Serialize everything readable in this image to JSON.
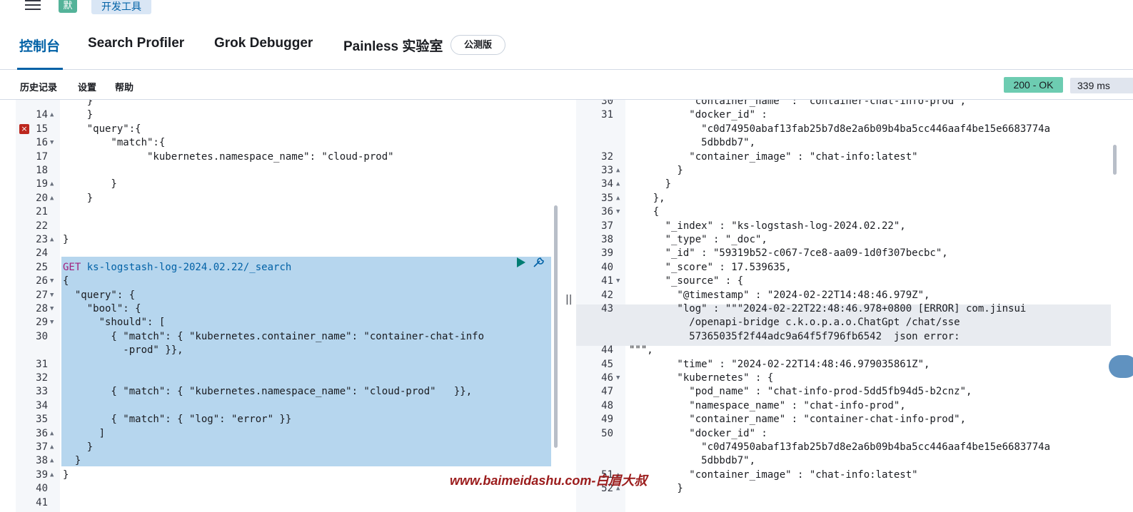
{
  "topbar": {
    "space_initial": "默",
    "breadcrumb": "开发工具"
  },
  "tabs": [
    {
      "label": "控制台",
      "active": true
    },
    {
      "label": "Search Profiler",
      "active": false
    },
    {
      "label": "Grok Debugger",
      "active": false
    },
    {
      "label": "Painless 实验室",
      "active": false
    }
  ],
  "beta_badge": "公测版",
  "toolbar": {
    "history": "历史记录",
    "settings": "设置",
    "help": "帮助",
    "status": "200 - OK",
    "duration": "339 ms"
  },
  "request_editor": {
    "lines": [
      {
        "n": "",
        "text": "    }"
      },
      {
        "n": "14",
        "text": "    }"
      },
      {
        "n": "15",
        "text": "    \"query\":{"
      },
      {
        "n": "16",
        "text": "        \"match\":{"
      },
      {
        "n": "17",
        "text": "              \"kubernetes.namespace_name\": \"cloud-prod\""
      },
      {
        "n": "18",
        "text": ""
      },
      {
        "n": "19",
        "text": "        }"
      },
      {
        "n": "20",
        "text": "    }"
      },
      {
        "n": "21",
        "text": ""
      },
      {
        "n": "22",
        "text": ""
      },
      {
        "n": "23",
        "text": "}"
      },
      {
        "n": "24",
        "text": ""
      },
      {
        "n": "25",
        "text": "GET ks-logstash-log-2024.02.22/_search"
      },
      {
        "n": "26",
        "text": "{"
      },
      {
        "n": "27",
        "text": "  \"query\": {"
      },
      {
        "n": "28",
        "text": "    \"bool\": {"
      },
      {
        "n": "29",
        "text": "      \"should\": ["
      },
      {
        "n": "30",
        "text": "        { \"match\": { \"kubernetes.container_name\": \"container-chat-info"
      },
      {
        "n": "",
        "text": "          -prod\" }},"
      },
      {
        "n": "31",
        "text": ""
      },
      {
        "n": "32",
        "text": ""
      },
      {
        "n": "33",
        "text": "        { \"match\": { \"kubernetes.namespace_name\": \"cloud-prod\"   }},"
      },
      {
        "n": "34",
        "text": ""
      },
      {
        "n": "35",
        "text": "        { \"match\": { \"log\": \"error\" }}"
      },
      {
        "n": "36",
        "text": "      ]"
      },
      {
        "n": "37",
        "text": "    }"
      },
      {
        "n": "38",
        "text": "  }"
      },
      {
        "n": "39",
        "text": "}"
      },
      {
        "n": "40",
        "text": ""
      },
      {
        "n": "41",
        "text": ""
      }
    ]
  },
  "response_editor": {
    "lines": [
      {
        "n": "30",
        "text": "          \"container_name\" : \"container-chat-info-prod\","
      },
      {
        "n": "31",
        "text": "          \"docker_id\" :"
      },
      {
        "n": "",
        "text": "            \"c0d74950abaf13fab25b7d8e2a6b09b4ba5cc446aaf4be15e6683774a"
      },
      {
        "n": "",
        "text": "            5dbbdb7\","
      },
      {
        "n": "32",
        "text": "          \"container_image\" : \"chat-info:latest\""
      },
      {
        "n": "33",
        "text": "        }"
      },
      {
        "n": "34",
        "text": "      }"
      },
      {
        "n": "35",
        "text": "    },"
      },
      {
        "n": "36",
        "text": "    {"
      },
      {
        "n": "37",
        "text": "      \"_index\" : \"ks-logstash-log-2024.02.22\","
      },
      {
        "n": "38",
        "text": "      \"_type\" : \"_doc\","
      },
      {
        "n": "39",
        "text": "      \"_id\" : \"59319b52-c067-7ce8-aa09-1d0f307becbc\","
      },
      {
        "n": "40",
        "text": "      \"_score\" : 17.539635,"
      },
      {
        "n": "41",
        "text": "      \"_source\" : {"
      },
      {
        "n": "42",
        "text": "        \"@timestamp\" : \"2024-02-22T14:48:46.979Z\","
      },
      {
        "n": "43",
        "text": "        \"log\" : \"\"\"2024-02-22T22:48:46.978+0800 [ERROR] com.jinsui"
      },
      {
        "n": "",
        "text": "          /openapi-bridge c.k.o.p.a.o.ChatGpt /chat/sse"
      },
      {
        "n": "",
        "text": "          57365035f2f44adc9a64f5f796fb6542  json error:"
      },
      {
        "n": "44",
        "text": "\"\"\","
      },
      {
        "n": "45",
        "text": "        \"time\" : \"2024-02-22T14:48:46.979035861Z\","
      },
      {
        "n": "46",
        "text": "        \"kubernetes\" : {"
      },
      {
        "n": "47",
        "text": "          \"pod_name\" : \"chat-info-prod-5dd5fb94d5-b2cnz\","
      },
      {
        "n": "48",
        "text": "          \"namespace_name\" : \"chat-info-prod\","
      },
      {
        "n": "49",
        "text": "          \"container_name\" : \"container-chat-info-prod\","
      },
      {
        "n": "50",
        "text": "          \"docker_id\" :"
      },
      {
        "n": "",
        "text": "            \"c0d74950abaf13fab25b7d8e2a6b09b4ba5cc446aaf4be15e6683774a"
      },
      {
        "n": "",
        "text": "            5dbbdb7\","
      },
      {
        "n": "51",
        "text": "          \"container_image\" : \"chat-info:latest\""
      },
      {
        "n": "52",
        "text": "        }"
      }
    ]
  },
  "watermark": "www.baimeidashu.com-白眉大叔"
}
